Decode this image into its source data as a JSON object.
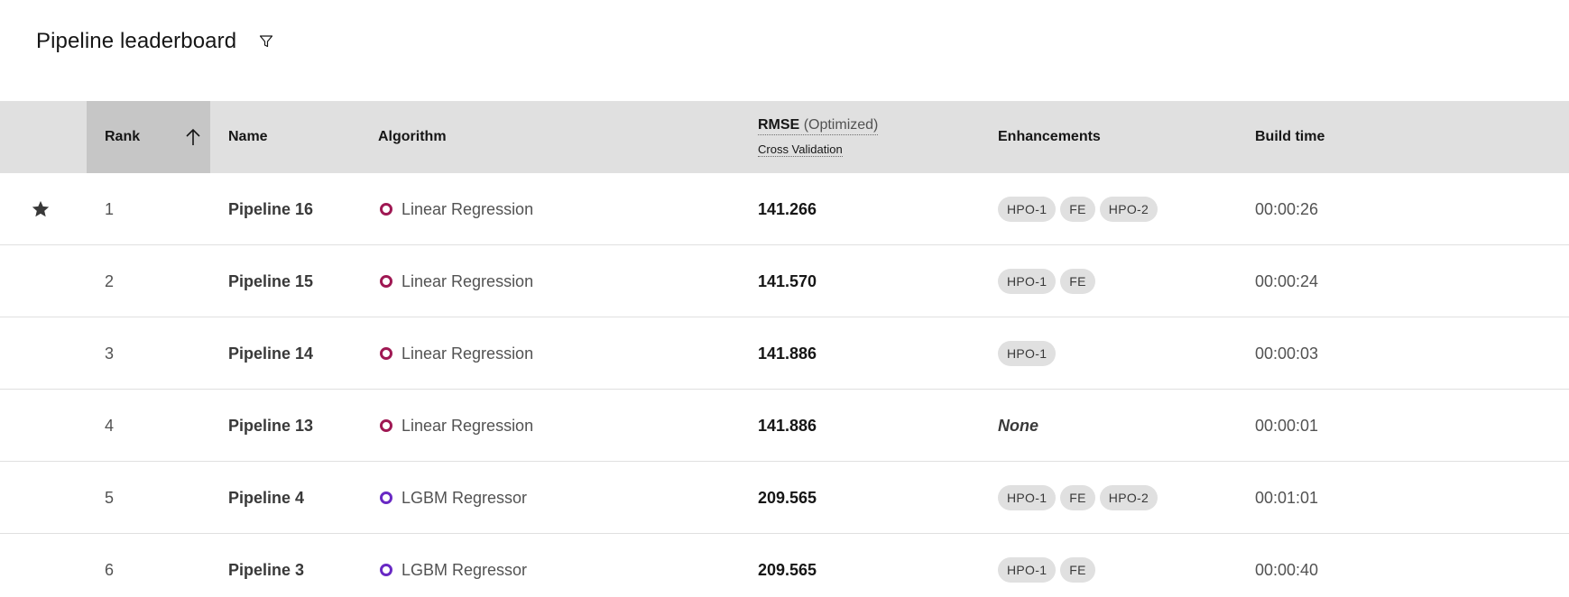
{
  "header": {
    "title": "Pipeline leaderboard",
    "filter_icon": "filter-icon"
  },
  "columns": {
    "rank": "Rank",
    "name": "Name",
    "algorithm": "Algorithm",
    "metric": "RMSE",
    "metric_note": "(Optimized)",
    "metric_sub": "Cross Validation",
    "enhancements": "Enhancements",
    "build_time": "Build time"
  },
  "sort": {
    "column": "Rank",
    "direction": "ascending",
    "icon": "arrow-up-icon"
  },
  "colors": {
    "linear_regression": "#9f1853",
    "lgbm_regressor": "#6929c4",
    "header_bg": "#e0e0e0",
    "sorted_header_bg": "#c6c6c6",
    "tag_bg": "#e0e0e0"
  },
  "rows": [
    {
      "star": true,
      "rank": "1",
      "name": "Pipeline 16",
      "algorithm": "Linear Regression",
      "rmse": "141.266",
      "enhancements": [
        "HPO-1",
        "FE",
        "HPO-2"
      ],
      "none_label": "",
      "build_time": "00:00:26"
    },
    {
      "star": false,
      "rank": "2",
      "name": "Pipeline 15",
      "algorithm": "Linear Regression",
      "rmse": "141.570",
      "enhancements": [
        "HPO-1",
        "FE"
      ],
      "none_label": "",
      "build_time": "00:00:24"
    },
    {
      "star": false,
      "rank": "3",
      "name": "Pipeline 14",
      "algorithm": "Linear Regression",
      "rmse": "141.886",
      "enhancements": [
        "HPO-1"
      ],
      "none_label": "",
      "build_time": "00:00:03"
    },
    {
      "star": false,
      "rank": "4",
      "name": "Pipeline 13",
      "algorithm": "Linear Regression",
      "rmse": "141.886",
      "enhancements": [],
      "none_label": "None",
      "build_time": "00:00:01"
    },
    {
      "star": false,
      "rank": "5",
      "name": "Pipeline 4",
      "algorithm": "LGBM Regressor",
      "rmse": "209.565",
      "enhancements": [
        "HPO-1",
        "FE",
        "HPO-2"
      ],
      "none_label": "",
      "build_time": "00:01:01"
    },
    {
      "star": false,
      "rank": "6",
      "name": "Pipeline 3",
      "algorithm": "LGBM Regressor",
      "rmse": "209.565",
      "enhancements": [
        "HPO-1",
        "FE"
      ],
      "none_label": "",
      "build_time": "00:00:40"
    }
  ]
}
